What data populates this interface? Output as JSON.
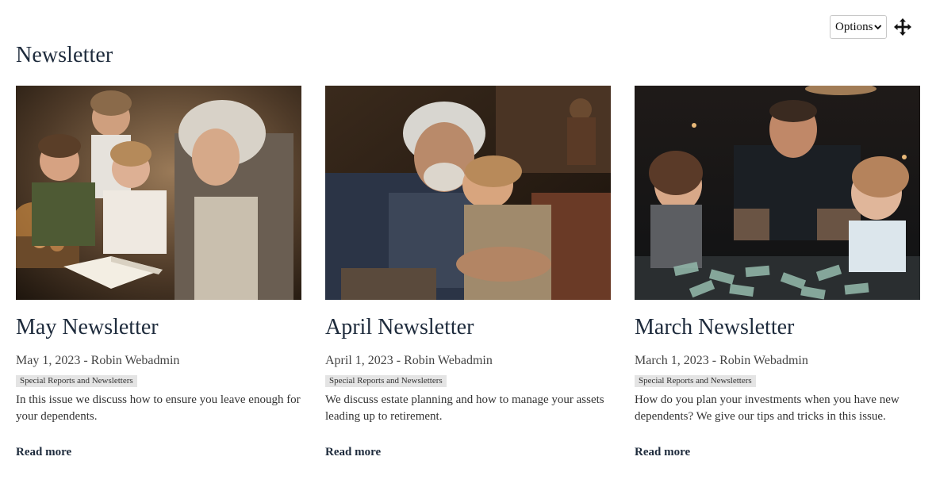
{
  "toolbar": {
    "options_label": "Options"
  },
  "page": {
    "title": "Newsletter"
  },
  "cards": [
    {
      "title": "May Newsletter",
      "meta": "May 1, 2023 - Robin Webadmin",
      "tag": "Special Reports and Newsletters",
      "description": "In this issue we discuss how to ensure you leave enough for your dependents.",
      "read_more": "Read more"
    },
    {
      "title": "April Newsletter",
      "meta": "April 1, 2023 - Robin Webadmin",
      "tag": "Special Reports and Newsletters",
      "description": "We discuss estate planning and how to manage your assets leading up to retirement.",
      "read_more": "Read more"
    },
    {
      "title": "March Newsletter",
      "meta": "March 1, 2023 - Robin Webadmin",
      "tag": "Special Reports and Newsletters",
      "description": "How do you plan your investments when you have new dependents? We give our tips and tricks in this issue.",
      "read_more": "Read more"
    }
  ]
}
